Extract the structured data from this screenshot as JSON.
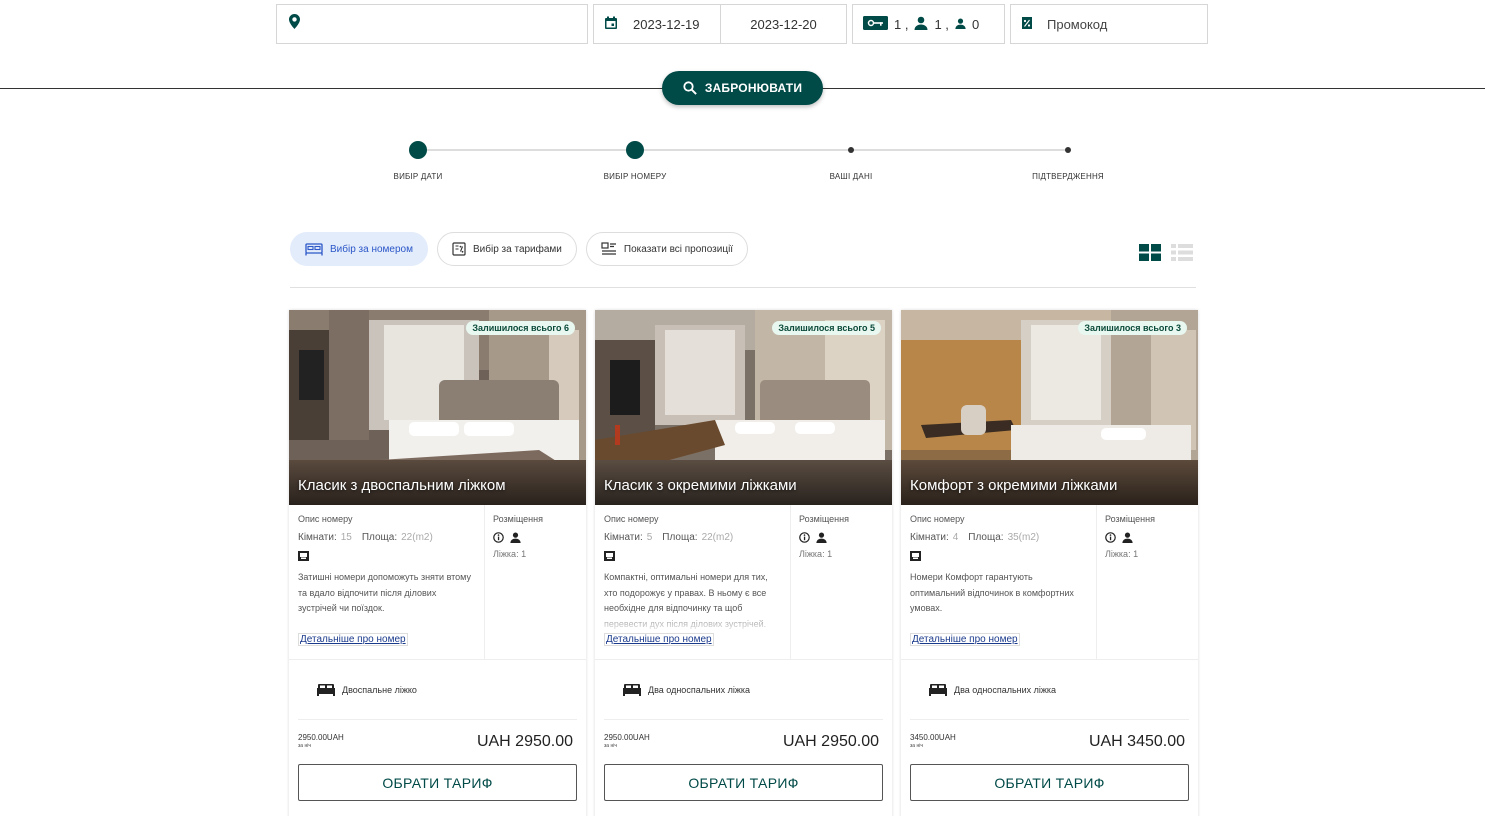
{
  "search": {
    "location_placeholder": "",
    "check_in": "2023-12-19",
    "check_out": "2023-12-20",
    "rooms": "1 ,",
    "adults": "1 ,",
    "children": "0",
    "promo_placeholder": "Промокод",
    "book_label": "ЗАБРОНЮВАТИ"
  },
  "stepper": [
    {
      "label": "ВИБІР ДАТИ",
      "done": true
    },
    {
      "label": "ВИБІР НОМЕРУ",
      "done": true
    },
    {
      "label": "ВАШІ ДАНІ",
      "done": false
    },
    {
      "label": "ПІДТВЕРДЖЕННЯ",
      "done": false
    }
  ],
  "filters": {
    "by_room": "Вибір за номером",
    "by_rate": "Вибір за тарифами",
    "show_all": "Показати всі пропозиції"
  },
  "colors": {
    "accent": "#004a47",
    "active_pill_bg": "#e3ecfb",
    "active_pill_text": "#2b57c8",
    "badge_bg": "#e8f7ef"
  },
  "labels": {
    "description": "Опис номеру",
    "rooms": "Кімнати:",
    "area": "Площа:",
    "placement": "Розміщення",
    "more": "Детальніше про номер",
    "per_night": "за ніч",
    "choose": "ОБРАТИ ТАРИФ"
  },
  "cards": [
    {
      "badge": "Залишилося всього 6",
      "name": "Класик з двоспальним ліжком",
      "rooms": "15",
      "area": "22(m2)",
      "description": "Затишні номери допоможуть зняти втому та вдало відпочити після ділових зустрічей чи поїздок.",
      "beds_count": "Ліжка: 1",
      "bed_type": "Двоспальне ліжко",
      "price_small": "2950.00UAH",
      "price_big": "UAH 2950.00"
    },
    {
      "badge": "Залишилося всього 5",
      "name": "Класик з окремими ліжками",
      "rooms": "5",
      "area": "22(m2)",
      "description": "Компактні, оптимальні номери для тих, хто подорожує у правах. В ньому є все необхідне для відпочинку та щоб перевести дух після ділових зустрічей.",
      "beds_count": "Ліжка: 1",
      "bed_type": "Два односпальних ліжка",
      "price_small": "2950.00UAH",
      "price_big": "UAH 2950.00"
    },
    {
      "badge": "Залишилося всього 3",
      "name": "Комфорт з окремими ліжками",
      "rooms": "4",
      "area": "35(m2)",
      "description": "Номери Комфорт гарантують оптимальний відпочинок в комфортних умовах.",
      "beds_count": "Ліжка: 1",
      "bed_type": "Два односпальних ліжка",
      "price_small": "3450.00UAH",
      "price_big": "UAH 3450.00"
    }
  ]
}
